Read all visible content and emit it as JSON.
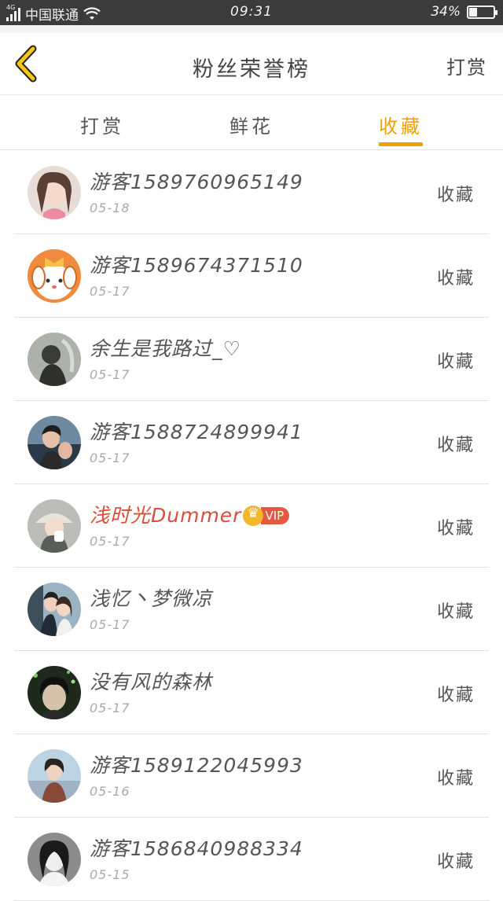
{
  "status": {
    "network": "4G",
    "carrier": "中国联通",
    "time": "09:31",
    "battery": "34%",
    "battery_level": 0.34
  },
  "header": {
    "back_icon": "chevron-left-icon",
    "title": "粉丝荣誉榜",
    "action": "打赏"
  },
  "tabs": [
    {
      "label": "打赏"
    },
    {
      "label": "鲜花"
    },
    {
      "label": "收藏"
    }
  ],
  "active_tab": "收藏",
  "accent_color": "#f0a000",
  "vip_color": "#d94e3a",
  "fans": [
    {
      "name": "游客15897609651​49",
      "date": "05-18",
      "action": "收藏"
    },
    {
      "name": "游客15896743715​10",
      "date": "05-17",
      "action": "收藏"
    },
    {
      "name": "余生是我路过_♡",
      "date": "05-17",
      "action": "收藏"
    },
    {
      "name": "游客15887248999​41",
      "date": "05-17",
      "action": "收藏"
    },
    {
      "name": "浅时光Dummer",
      "vip_badge": "VIP",
      "date": "05-17",
      "action": "收藏"
    },
    {
      "name": "浅忆丶梦微凉",
      "date": "05-17",
      "action": "收藏"
    },
    {
      "name": "没有风的森林",
      "date": "05-17",
      "action": "收藏"
    },
    {
      "name": "游客15891220459​93",
      "date": "05-16",
      "action": "收藏"
    },
    {
      "name": "游客15868409883​34",
      "date": "05-15",
      "action": "收藏"
    }
  ]
}
